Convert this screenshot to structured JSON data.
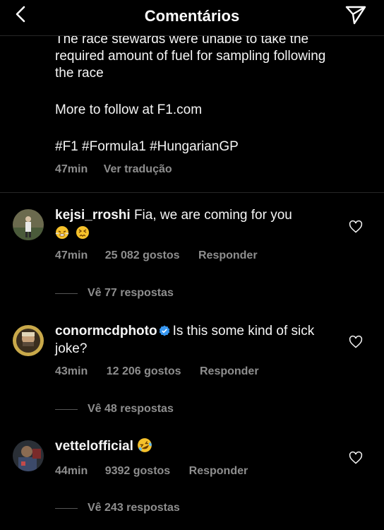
{
  "header": {
    "title": "Comentários"
  },
  "caption": {
    "lines": [
      "The race stewards were unable to take the",
      "required amount of fuel for sampling following",
      "the race",
      "More to follow at F1.com",
      "#F1 #Formula1 #HungarianGP"
    ],
    "time": "47min",
    "translate": "Ver tradução"
  },
  "comments": [
    {
      "user": "kejsi_rroshi",
      "text": "Fia, we are coming for you",
      "emojis": [
        "triumph-face-emoji",
        "confounded-face-emoji"
      ],
      "time": "47min",
      "likes": "25 082 gostos",
      "reply": "Responder",
      "replies": "Vê 77 respostas",
      "verified": false
    },
    {
      "user": "conormcdphoto",
      "text": "Is this some kind of sick joke?",
      "time": "43min",
      "likes": "12 206 gostos",
      "reply": "Responder",
      "replies": "Vê 48 respostas",
      "verified": true
    },
    {
      "user": "vettelofficial",
      "text": "",
      "emojis": [
        "rolling-on-floor-laughing-emoji"
      ],
      "time": "44min",
      "likes": "9392 gostos",
      "reply": "Responder",
      "replies": "Vê 243 respostas",
      "verified": false
    }
  ],
  "colors": {
    "background": "#000000",
    "text": "#f5f5f5",
    "muted": "#8e8e8e",
    "verified": "#3897f0"
  }
}
